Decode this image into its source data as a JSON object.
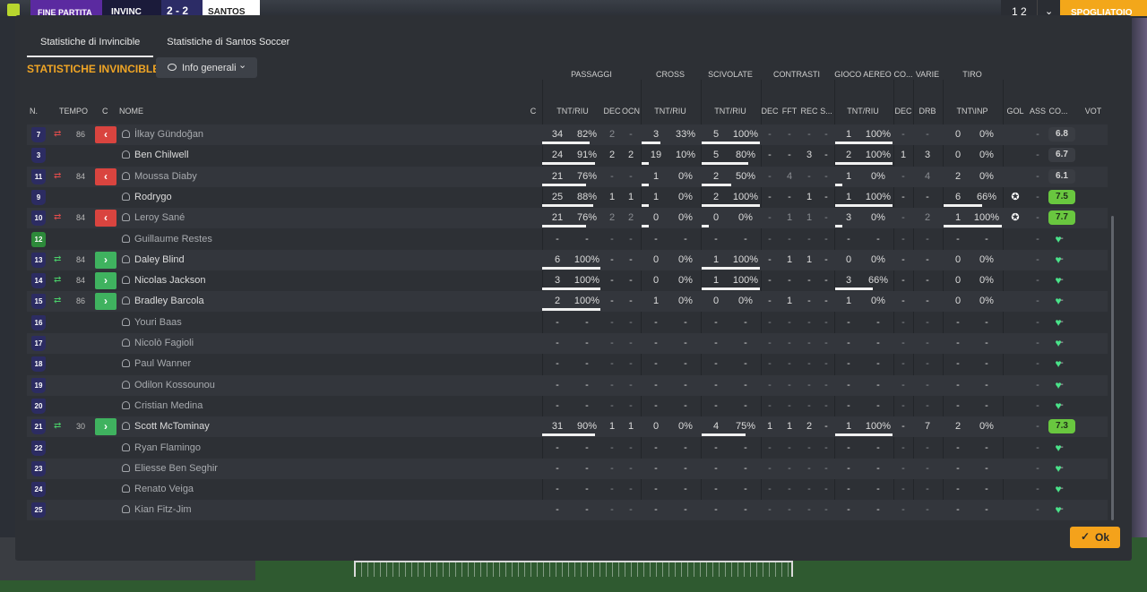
{
  "topbar": {
    "end_label": "FINE PARTITA",
    "home_team": "INVINC",
    "score": "2 - 2",
    "away_team": "SANTOS",
    "right_counter": "1 2",
    "right_chevron": "⌄",
    "right_action": "SPOGLIATOIO"
  },
  "modal": {
    "tabs": [
      "Statistiche di Invincible",
      "Statistiche di Santos Soccer"
    ],
    "section_title": "STATISTICHE INVINCIBLE",
    "dropdown_label": "Info generali",
    "ok_label": "Ok"
  },
  "groups": [
    "PASSAGGI",
    "CROSS",
    "SCIVOLATE",
    "CONTRASTI",
    "GIOCO AEREO",
    "CO...",
    "VARIE",
    "TIRO"
  ],
  "columns": {
    "num": "N.",
    "tempo": "TEMPO",
    "c": "C",
    "nome": "NOME",
    "c2": "C",
    "pass_tntriu": "TNT/RIU",
    "pass_dec": "DEC",
    "pass_ocn": "OCN",
    "cross_tntriu": "TNT/RIU",
    "sciv_tntriu": "TNT/RIU",
    "con_dec": "DEC",
    "con_fft": "FFT",
    "con_rec": "REC",
    "con_s": "S...",
    "aereo_tntriu": "TNT/RIU",
    "co_dec": "DEC",
    "varie_drb": "DRB",
    "tiro_tntinp": "TNT\\INP",
    "gol": "GOL",
    "ass": "ASS",
    "co": "CO...",
    "vot": "VOT"
  },
  "players": [
    {
      "num": "7",
      "sub": "out",
      "min": "86",
      "name": "İlkay Gündoğan",
      "active": false,
      "pass": [
        "34",
        "82%"
      ],
      "pdec": "2",
      "pocn": "-",
      "cross": [
        "3",
        "33%"
      ],
      "sciv": [
        "5",
        "100%"
      ],
      "con": [
        "-",
        "-",
        "-",
        "-"
      ],
      "aereo": [
        "1",
        "100%"
      ],
      "codec": "-",
      "drb": "-",
      "tiro": [
        "0",
        "0%"
      ],
      "gol": "",
      "ass": "-",
      "heart": "gold",
      "vot": "6.8",
      "vclass": "plain",
      "bars": {
        "pass": 0.82,
        "cross": 0.33,
        "sciv": 1.0,
        "aereo": 1.0
      }
    },
    {
      "num": "3",
      "sub": "",
      "min": "",
      "name": "Ben Chilwell",
      "active": true,
      "pass": [
        "24",
        "91%"
      ],
      "pdec": "2",
      "pocn": "2",
      "cross": [
        "19",
        "10%"
      ],
      "sciv": [
        "5",
        "80%"
      ],
      "con": [
        "-",
        "-",
        "3",
        "-"
      ],
      "aereo": [
        "2",
        "100%"
      ],
      "codec": "1",
      "drb": "3",
      "tiro": [
        "0",
        "0%"
      ],
      "gol": "",
      "ass": "-",
      "heart": "gold",
      "vot": "6.7",
      "vclass": "plain",
      "bars": {
        "pass": 0.91,
        "cross": 0.1,
        "sciv": 0.8,
        "aereo": 1.0
      }
    },
    {
      "num": "11",
      "sub": "out",
      "min": "84",
      "name": "Moussa Diaby",
      "active": false,
      "pass": [
        "21",
        "76%"
      ],
      "pdec": "-",
      "pocn": "-",
      "cross": [
        "1",
        "0%"
      ],
      "sciv": [
        "2",
        "50%"
      ],
      "con": [
        "-",
        "4",
        "-",
        "-"
      ],
      "aereo": [
        "1",
        "0%"
      ],
      "codec": "-",
      "drb": "4",
      "tiro": [
        "2",
        "0%"
      ],
      "gol": "",
      "ass": "-",
      "heart": "yellow",
      "vot": "6.1",
      "vclass": "plain",
      "bars": {
        "pass": 0.76,
        "cross": 0,
        "sciv": 0.5,
        "aereo": 0
      }
    },
    {
      "num": "9",
      "sub": "",
      "min": "",
      "name": "Rodrygo",
      "active": true,
      "pass": [
        "25",
        "88%"
      ],
      "pdec": "1",
      "pocn": "1",
      "cross": [
        "1",
        "0%"
      ],
      "sciv": [
        "2",
        "100%"
      ],
      "con": [
        "-",
        "-",
        "1",
        "-"
      ],
      "aereo": [
        "1",
        "100%"
      ],
      "codec": "-",
      "drb": "-",
      "tiro": [
        "6",
        "66%"
      ],
      "gol": "ball",
      "ass": "-",
      "heart": "gold",
      "vot": "7.5",
      "vclass": "good",
      "bars": {
        "pass": 0.88,
        "cross": 0,
        "sciv": 1.0,
        "aereo": 1.0,
        "tiro": 0.66
      }
    },
    {
      "num": "10",
      "sub": "out",
      "min": "84",
      "name": "Leroy Sané",
      "active": false,
      "pass": [
        "21",
        "76%"
      ],
      "pdec": "2",
      "pocn": "2",
      "cross": [
        "0",
        "0%"
      ],
      "sciv": [
        "0",
        "0%"
      ],
      "con": [
        "-",
        "1",
        "1",
        "-"
      ],
      "aereo": [
        "3",
        "0%"
      ],
      "codec": "-",
      "drb": "2",
      "tiro": [
        "1",
        "100%"
      ],
      "gol": "ball",
      "ass": "-",
      "heart": "gold",
      "vot": "7.7",
      "vclass": "good",
      "bars": {
        "pass": 0.76,
        "cross": 0,
        "sciv": 0,
        "aereo": 0,
        "tiro": 1.0
      }
    },
    {
      "num": "12",
      "sub": "",
      "min": "",
      "name": "Guillaume Restes",
      "active": false,
      "gk": true,
      "pass": [
        "-",
        "-"
      ],
      "pdec": "-",
      "pocn": "-",
      "cross": [
        "-",
        "-"
      ],
      "sciv": [
        "-",
        "-"
      ],
      "con": [
        "-",
        "-",
        "-",
        "-"
      ],
      "aereo": [
        "-",
        "-"
      ],
      "codec": "-",
      "drb": "-",
      "tiro": [
        "-",
        "-"
      ],
      "gol": "",
      "ass": "-",
      "heart": "green",
      "vot": "-",
      "vclass": "none",
      "bars": {}
    },
    {
      "num": "13",
      "sub": "in",
      "min": "84",
      "name": "Daley Blind",
      "active": true,
      "pass": [
        "6",
        "100%"
      ],
      "pdec": "-",
      "pocn": "-",
      "cross": [
        "0",
        "0%"
      ],
      "sciv": [
        "1",
        "100%"
      ],
      "con": [
        "-",
        "1",
        "1",
        "-"
      ],
      "aereo": [
        "0",
        "0%"
      ],
      "codec": "-",
      "drb": "-",
      "tiro": [
        "0",
        "0%"
      ],
      "gol": "",
      "ass": "-",
      "heart": "green",
      "vot": "-",
      "vclass": "none",
      "bars": {
        "pass": 1.0,
        "sciv": 1.0
      }
    },
    {
      "num": "14",
      "sub": "in",
      "min": "84",
      "name": "Nicolas Jackson",
      "active": true,
      "pass": [
        "3",
        "100%"
      ],
      "pdec": "-",
      "pocn": "-",
      "cross": [
        "0",
        "0%"
      ],
      "sciv": [
        "1",
        "100%"
      ],
      "con": [
        "-",
        "-",
        "-",
        "-"
      ],
      "aereo": [
        "3",
        "66%"
      ],
      "codec": "-",
      "drb": "-",
      "tiro": [
        "0",
        "0%"
      ],
      "gol": "",
      "ass": "-",
      "heart": "green",
      "vot": "-",
      "vclass": "none",
      "bars": {
        "pass": 1.0,
        "sciv": 1.0,
        "aereo": 0.66
      }
    },
    {
      "num": "15",
      "sub": "in",
      "min": "86",
      "name": "Bradley Barcola",
      "active": true,
      "pass": [
        "2",
        "100%"
      ],
      "pdec": "-",
      "pocn": "-",
      "cross": [
        "1",
        "0%"
      ],
      "sciv": [
        "0",
        "0%"
      ],
      "con": [
        "-",
        "1",
        "-",
        "-"
      ],
      "aereo": [
        "1",
        "0%"
      ],
      "codec": "-",
      "drb": "-",
      "tiro": [
        "0",
        "0%"
      ],
      "gol": "",
      "ass": "-",
      "heart": "green",
      "vot": "-",
      "vclass": "none",
      "bars": {
        "pass": 1.0
      }
    },
    {
      "num": "16",
      "sub": "",
      "min": "",
      "name": "Youri Baas",
      "active": false,
      "pass": [
        "-",
        "-"
      ],
      "pdec": "-",
      "pocn": "-",
      "cross": [
        "-",
        "-"
      ],
      "sciv": [
        "-",
        "-"
      ],
      "con": [
        "-",
        "-",
        "-",
        "-"
      ],
      "aereo": [
        "-",
        "-"
      ],
      "codec": "-",
      "drb": "-",
      "tiro": [
        "-",
        "-"
      ],
      "gol": "",
      "ass": "-",
      "heart": "green",
      "vot": "-",
      "vclass": "none",
      "bars": {}
    },
    {
      "num": "17",
      "sub": "",
      "min": "",
      "name": "Nicolò Fagioli",
      "active": false,
      "pass": [
        "-",
        "-"
      ],
      "pdec": "-",
      "pocn": "-",
      "cross": [
        "-",
        "-"
      ],
      "sciv": [
        "-",
        "-"
      ],
      "con": [
        "-",
        "-",
        "-",
        "-"
      ],
      "aereo": [
        "-",
        "-"
      ],
      "codec": "-",
      "drb": "-",
      "tiro": [
        "-",
        "-"
      ],
      "gol": "",
      "ass": "-",
      "heart": "green",
      "vot": "-",
      "vclass": "none",
      "bars": {}
    },
    {
      "num": "18",
      "sub": "",
      "min": "",
      "name": "Paul Wanner",
      "active": false,
      "pass": [
        "-",
        "-"
      ],
      "pdec": "-",
      "pocn": "-",
      "cross": [
        "-",
        "-"
      ],
      "sciv": [
        "-",
        "-"
      ],
      "con": [
        "-",
        "-",
        "-",
        "-"
      ],
      "aereo": [
        "-",
        "-"
      ],
      "codec": "-",
      "drb": "-",
      "tiro": [
        "-",
        "-"
      ],
      "gol": "",
      "ass": "-",
      "heart": "green",
      "vot": "-",
      "vclass": "none",
      "bars": {}
    },
    {
      "num": "19",
      "sub": "",
      "min": "",
      "name": "Odilon Kossounou",
      "active": false,
      "pass": [
        "-",
        "-"
      ],
      "pdec": "-",
      "pocn": "-",
      "cross": [
        "-",
        "-"
      ],
      "sciv": [
        "-",
        "-"
      ],
      "con": [
        "-",
        "-",
        "-",
        "-"
      ],
      "aereo": [
        "-",
        "-"
      ],
      "codec": "-",
      "drb": "-",
      "tiro": [
        "-",
        "-"
      ],
      "gol": "",
      "ass": "-",
      "heart": "green",
      "vot": "-",
      "vclass": "none",
      "bars": {}
    },
    {
      "num": "20",
      "sub": "",
      "min": "",
      "name": "Cristian Medina",
      "active": false,
      "pass": [
        "-",
        "-"
      ],
      "pdec": "-",
      "pocn": "-",
      "cross": [
        "-",
        "-"
      ],
      "sciv": [
        "-",
        "-"
      ],
      "con": [
        "-",
        "-",
        "-",
        "-"
      ],
      "aereo": [
        "-",
        "-"
      ],
      "codec": "-",
      "drb": "-",
      "tiro": [
        "-",
        "-"
      ],
      "gol": "",
      "ass": "-",
      "heart": "green",
      "vot": "-",
      "vclass": "none",
      "bars": {}
    },
    {
      "num": "21",
      "sub": "in",
      "min": "30",
      "name": "Scott McTominay",
      "active": true,
      "pass": [
        "31",
        "90%"
      ],
      "pdec": "1",
      "pocn": "1",
      "cross": [
        "0",
        "0%"
      ],
      "sciv": [
        "4",
        "75%"
      ],
      "con": [
        "1",
        "1",
        "2",
        "-"
      ],
      "aereo": [
        "1",
        "100%"
      ],
      "codec": "-",
      "drb": "7",
      "tiro": [
        "2",
        "0%"
      ],
      "gol": "",
      "ass": "-",
      "heart": "yellow",
      "vot": "7.3",
      "vclass": "good",
      "bars": {
        "pass": 0.9,
        "sciv": 0.75,
        "aereo": 1.0
      }
    },
    {
      "num": "22",
      "sub": "",
      "min": "",
      "name": "Ryan Flamingo",
      "active": false,
      "pass": [
        "-",
        "-"
      ],
      "pdec": "-",
      "pocn": "-",
      "cross": [
        "-",
        "-"
      ],
      "sciv": [
        "-",
        "-"
      ],
      "con": [
        "-",
        "-",
        "-",
        "-"
      ],
      "aereo": [
        "-",
        "-"
      ],
      "codec": "-",
      "drb": "-",
      "tiro": [
        "-",
        "-"
      ],
      "gol": "",
      "ass": "-",
      "heart": "green",
      "vot": "-",
      "vclass": "none",
      "bars": {}
    },
    {
      "num": "23",
      "sub": "",
      "min": "",
      "name": "Eliesse Ben Seghir",
      "active": false,
      "pass": [
        "-",
        "-"
      ],
      "pdec": "-",
      "pocn": "-",
      "cross": [
        "-",
        "-"
      ],
      "sciv": [
        "-",
        "-"
      ],
      "con": [
        "-",
        "-",
        "-",
        "-"
      ],
      "aereo": [
        "-",
        "-"
      ],
      "codec": "-",
      "drb": "-",
      "tiro": [
        "-",
        "-"
      ],
      "gol": "",
      "ass": "-",
      "heart": "green",
      "vot": "-",
      "vclass": "none",
      "bars": {}
    },
    {
      "num": "24",
      "sub": "",
      "min": "",
      "name": "Renato Veiga",
      "active": false,
      "pass": [
        "-",
        "-"
      ],
      "pdec": "-",
      "pocn": "-",
      "cross": [
        "-",
        "-"
      ],
      "sciv": [
        "-",
        "-"
      ],
      "con": [
        "-",
        "-",
        "-",
        "-"
      ],
      "aereo": [
        "-",
        "-"
      ],
      "codec": "-",
      "drb": "-",
      "tiro": [
        "-",
        "-"
      ],
      "gol": "",
      "ass": "-",
      "heart": "green",
      "vot": "-",
      "vclass": "none",
      "bars": {}
    },
    {
      "num": "25",
      "sub": "",
      "min": "",
      "name": "Kian Fitz-Jim",
      "active": false,
      "pass": [
        "-",
        "-"
      ],
      "pdec": "-",
      "pocn": "-",
      "cross": [
        "-",
        "-"
      ],
      "sciv": [
        "-",
        "-"
      ],
      "con": [
        "-",
        "-",
        "-",
        "-"
      ],
      "aereo": [
        "-",
        "-"
      ],
      "codec": "-",
      "drb": "-",
      "tiro": [
        "-",
        "-"
      ],
      "gol": "",
      "ass": "-",
      "heart": "green",
      "vot": "-",
      "vclass": "none",
      "bars": {}
    }
  ]
}
